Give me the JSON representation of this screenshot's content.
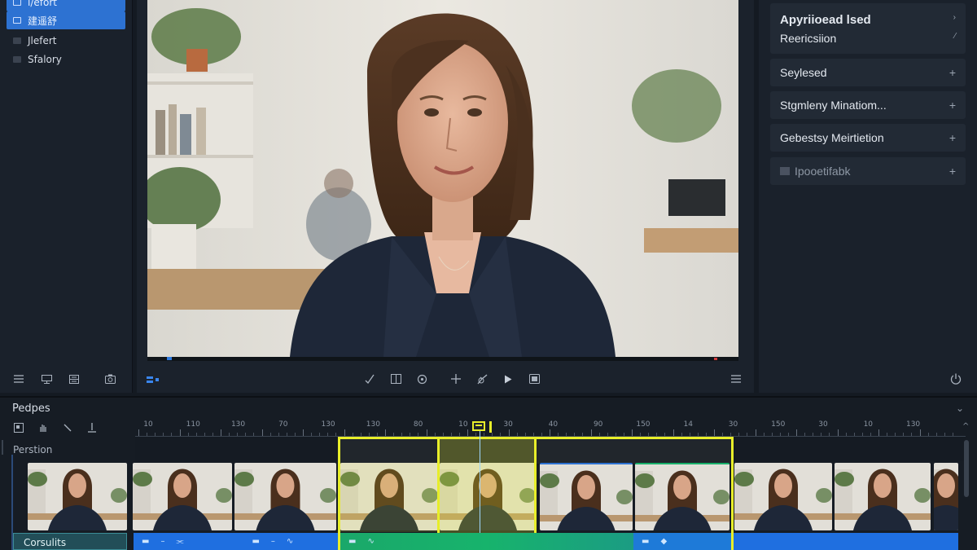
{
  "sidebar": {
    "items": [
      {
        "label": "l/efort",
        "icon": "layer-icon",
        "active": true
      },
      {
        "label": "建遥舒",
        "icon": "layer-icon",
        "active": true
      },
      {
        "label": "Jlefert",
        "icon": "folder-icon",
        "active": false
      },
      {
        "label": "Sfalory",
        "icon": "folder-icon",
        "active": false
      }
    ],
    "bottom_tools": [
      "list-icon",
      "monitor-icon",
      "grid-icon",
      "camera-icon"
    ]
  },
  "preview": {
    "toolbar_left": [
      "layout-toggle-icon"
    ],
    "controls": [
      "trim-icon",
      "crop-icon",
      "loop-icon",
      "add-icon",
      "effects-icon",
      "play-icon",
      "fullscreen-icon"
    ],
    "toolbar_right": [
      "menu-icon"
    ]
  },
  "properties": {
    "header_title": "Apyriioead lsed",
    "header_subtitle": "Reericsiion",
    "rows": [
      {
        "label": "Seylesed"
      },
      {
        "label": "Stgmleny Minatiom..."
      },
      {
        "label": "Gebestsy Meirtietion"
      },
      {
        "label": "Ipooetifabk"
      }
    ],
    "power_icon": "power-icon"
  },
  "timeline": {
    "title": "Pedpes",
    "track_label": "Perstion",
    "audio_label": "Corsulits",
    "ruler_labels": [
      "10",
      "110",
      "130",
      "70",
      "130",
      "130",
      "80",
      "10",
      "30",
      "40",
      "90",
      "150",
      "14",
      "30",
      "150",
      "30",
      "10",
      "130"
    ],
    "colors": {
      "accent": "#2d72d2",
      "selection": "#e8ee2a",
      "audio_blue": "#1f6fe0",
      "audio_green": "#18b06a"
    }
  }
}
